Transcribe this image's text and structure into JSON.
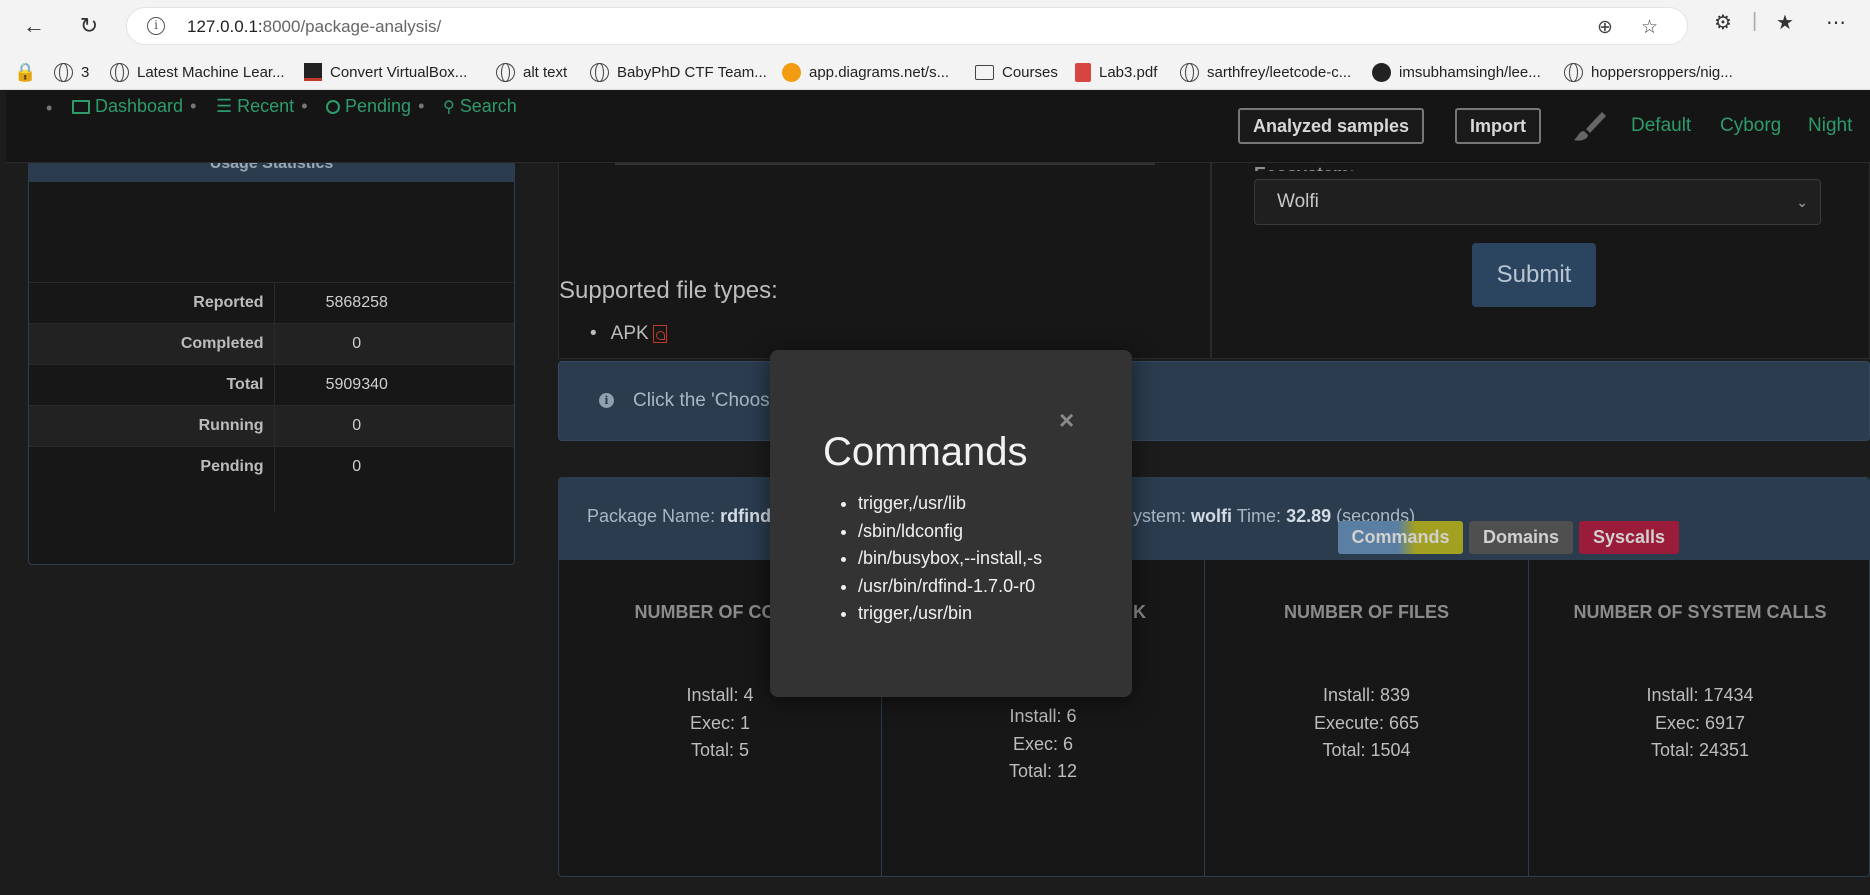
{
  "browser": {
    "url_host": "127.0.0.1:",
    "url_rest": "8000/package-analysis/",
    "bookmarks": [
      {
        "label": "3"
      },
      {
        "label": "Latest Machine Lear..."
      },
      {
        "label": "Convert VirtualBox..."
      },
      {
        "label": "alt text"
      },
      {
        "label": "BabyPhD CTF Team..."
      },
      {
        "label": "app.diagrams.net/s..."
      },
      {
        "label": "Courses"
      },
      {
        "label": "Lab3.pdf"
      },
      {
        "label": "sarthfrey/leetcode-c..."
      },
      {
        "label": "imsubhamsingh/lee..."
      },
      {
        "label": "hoppersroppers/nig..."
      }
    ]
  },
  "nav": {
    "links": [
      "Dashboard",
      "Recent",
      "Pending",
      "Search"
    ],
    "analyzed_label": "Analyzed samples",
    "import_label": "Import",
    "themes": [
      "Default",
      "Cyborg",
      "Night"
    ]
  },
  "stats": {
    "header": "Usage Statistics",
    "rows": [
      {
        "label": "Reported",
        "value": "5868258"
      },
      {
        "label": "Completed",
        "value": "0"
      },
      {
        "label": "Total",
        "value": "5909340"
      },
      {
        "label": "Running",
        "value": "0"
      },
      {
        "label": "Pending",
        "value": "0"
      }
    ]
  },
  "upload": {
    "filetypes_title": "Supported file types:",
    "filetype": "APK",
    "ecosystem_label": "Ecosystem:",
    "ecosystem_value": "Wolfi",
    "submit_label": "Submit",
    "info_text": "Click the 'Choose"
  },
  "result": {
    "package_label": "Package Name:",
    "package_value": "rdfind",
    "ecosystem_tail": "ystem:",
    "ecosystem_value": "wolfi",
    "time_label": "Time:",
    "time_value": "32.89",
    "time_unit": "(seconds)",
    "tags": [
      "Commands",
      "Domains",
      "Syscalls"
    ],
    "columns": [
      {
        "title": "NUMBER OF COMM",
        "values": [
          "Install: 4",
          "Exec: 1",
          "Total: 5"
        ]
      },
      {
        "title": "K",
        "values": [
          "Install: 6",
          "Exec: 6",
          "Total: 12"
        ]
      },
      {
        "title": "NUMBER OF FILES",
        "values": [
          "Install: 839",
          "Execute: 665",
          "Total: 1504"
        ]
      },
      {
        "title": "NUMBER OF SYSTEM CALLS",
        "values": [
          "Install: 17434",
          "Exec: 6917",
          "Total: 24351"
        ]
      }
    ]
  },
  "modal": {
    "close": "×",
    "title": "Commands",
    "items": [
      "trigger,/usr/lib",
      "/sbin/ldconfig",
      "/bin/busybox,--install,-s",
      "/usr/bin/rdfind-1.7.0-r0",
      "trigger,/usr/bin"
    ]
  },
  "colors": {
    "accent_green": "#2e9b6a",
    "panel_blue": "#2b3c4f",
    "commands_tag": "#5b7fa3",
    "commands_tag_yellow": "#a2a020",
    "domains_tag": "#4f4f4f",
    "syscalls_tag": "#9b1c3a"
  }
}
